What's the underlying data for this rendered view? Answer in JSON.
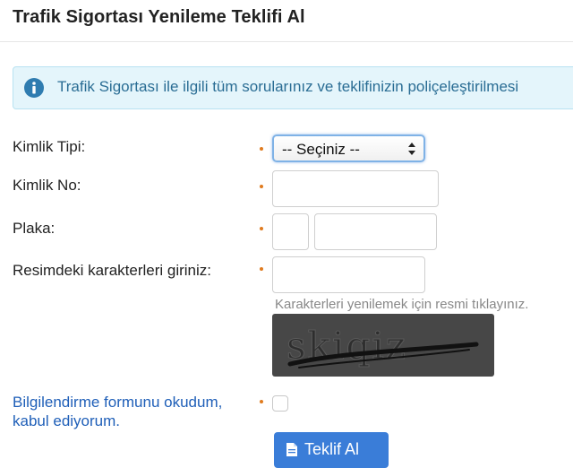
{
  "header": {
    "title": "Trafik Sigortası Yenileme Teklifi Al"
  },
  "info": {
    "text": "Trafik Sigortası ile ilgili tüm sorularınız ve teklifinizin poliçeleştirilmesi"
  },
  "form": {
    "identity_type": {
      "label": "Kimlik Tipi:",
      "selected": "-- Seçiniz --"
    },
    "identity_no": {
      "label": "Kimlik No:",
      "value": ""
    },
    "plate": {
      "label": "Plaka:",
      "value_part1": "",
      "value_part2": ""
    },
    "captcha": {
      "label": "Resimdeki karakterleri giriniz:",
      "value": "",
      "hint": "Karakterleri yenilemek için resmi tıklayınız.",
      "image_text": "skiqiz"
    },
    "consent": {
      "label_line1": "Bilgilendirme formunu okudum,",
      "label_line2": "kabul ediyorum.",
      "checked": false
    },
    "submit_label": "Teklif Al"
  },
  "colors": {
    "required_dot": "#e07b1f",
    "info_text": "#2a6d94",
    "info_bg": "#e4f5fb",
    "link_blue": "#1f5fb8",
    "button_blue": "#3a7dd8"
  },
  "icons": [
    "info-circle-icon",
    "select-arrows-icon",
    "document-icon"
  ]
}
